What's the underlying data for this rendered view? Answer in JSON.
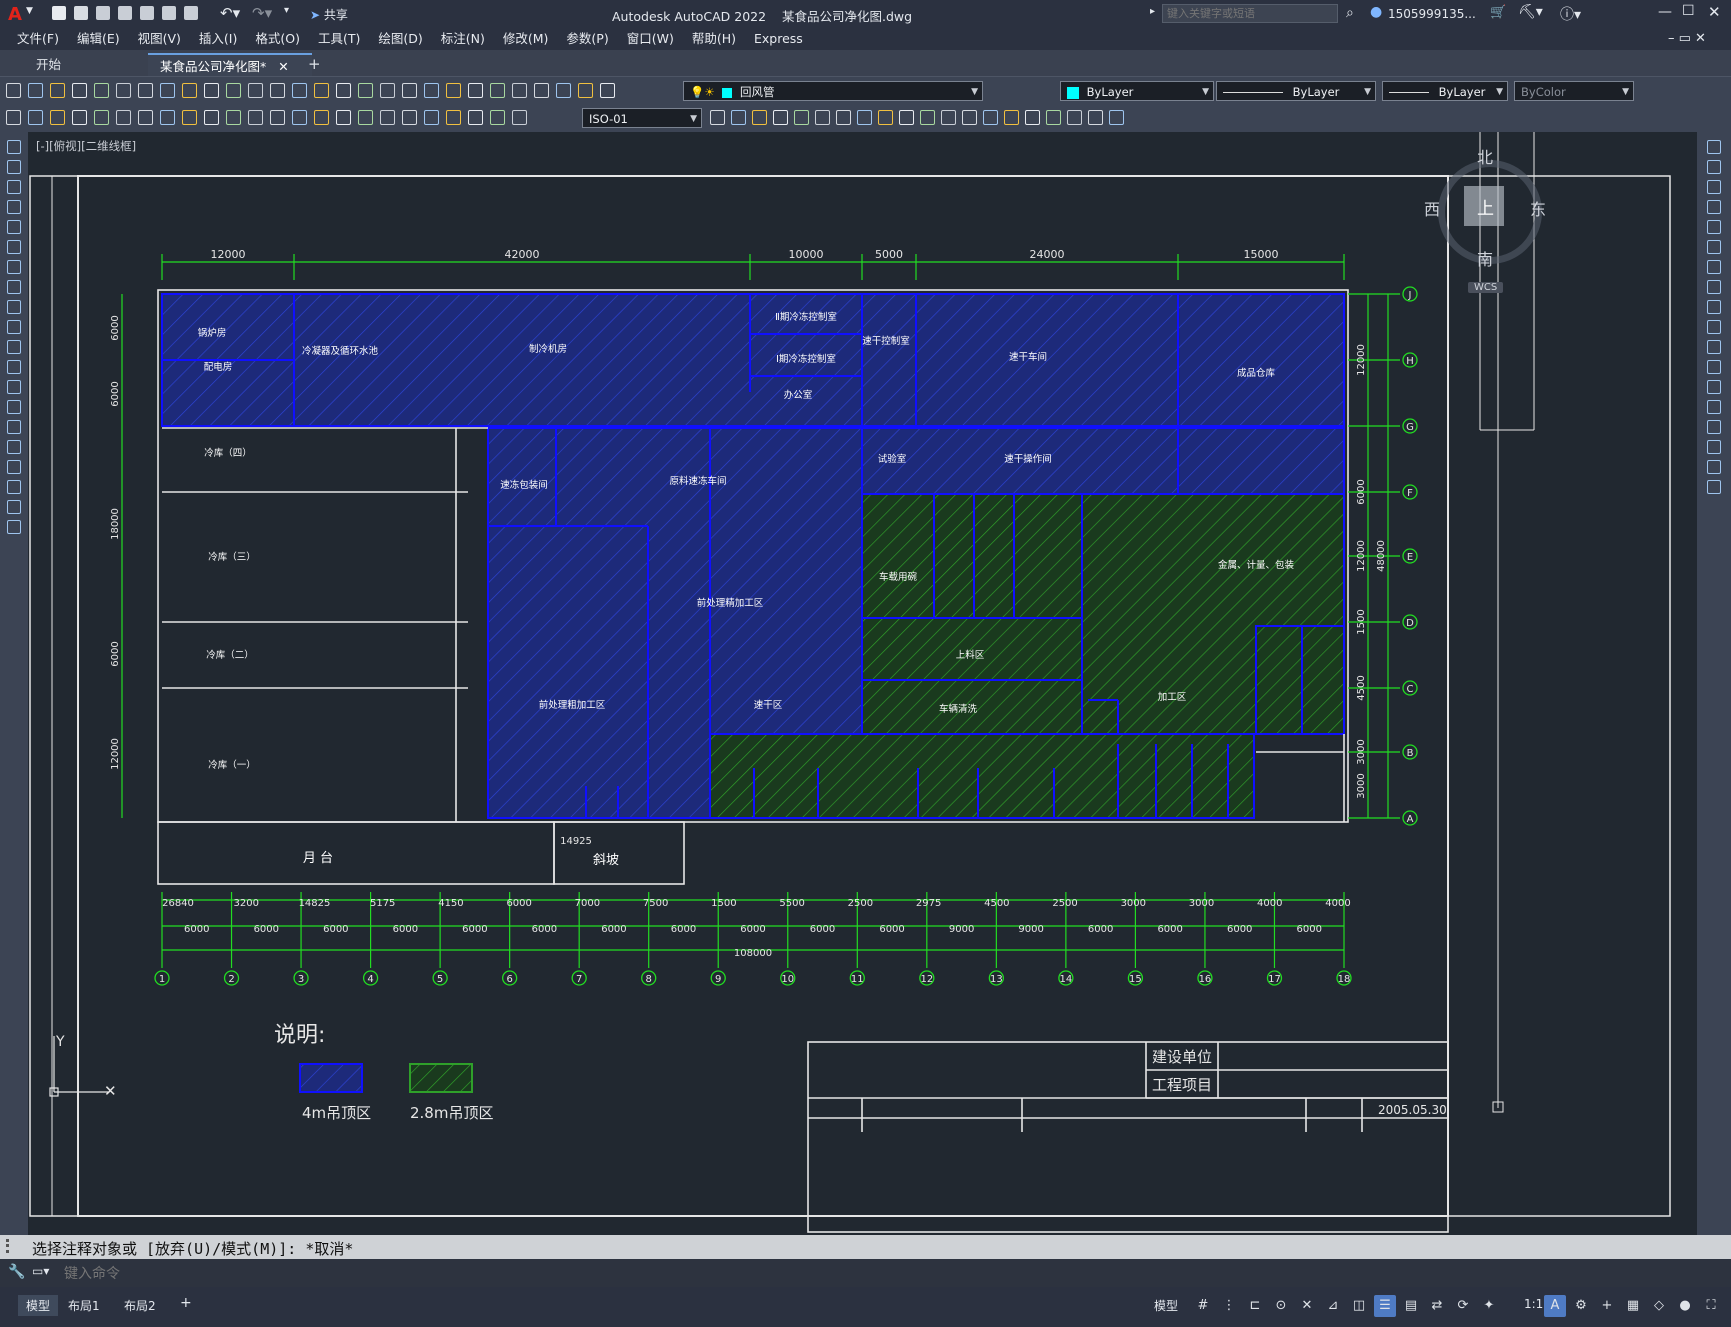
{
  "titlebar": {
    "app_title": "Autodesk AutoCAD 2022",
    "doc_title": "某食品公司净化图.dwg",
    "share_label": "共享",
    "search_placeholder": "键入关键字或短语",
    "user": "1505999135..."
  },
  "menu": [
    "文件(F)",
    "编辑(E)",
    "视图(V)",
    "插入(I)",
    "格式(O)",
    "工具(T)",
    "绘图(D)",
    "标注(N)",
    "修改(M)",
    "参数(P)",
    "窗口(W)",
    "帮助(H)",
    "Express"
  ],
  "tabs": [
    "开始",
    "某食品公司净化图*"
  ],
  "layer_value": "回风管",
  "color_value": "ByLayer",
  "linetype_value": "ByLayer",
  "lineweight_value": "ByLayer",
  "plotstyle_value": "ByColor",
  "dimstyle_value": "ISO-01",
  "viewport_label": "[-][俯视][二维线框]",
  "viewcube": {
    "north": "北",
    "south": "南",
    "east": "东",
    "west": "西",
    "top": "上",
    "wcs": "WCS"
  },
  "drawing": {
    "top_dims": [
      "12000",
      "42000",
      "10000",
      "5000",
      "24000",
      "15000"
    ],
    "right_axes": [
      "J",
      "H",
      "G",
      "F",
      "E",
      "D",
      "C",
      "B",
      "A"
    ],
    "right_dims": [
      "12000",
      "6000",
      "12000",
      "1500",
      "4500",
      "3000",
      "3000",
      "48000"
    ],
    "left_dims": [
      "6000",
      "6000",
      "18000",
      "6000",
      "12000"
    ],
    "bottom_dims_row1": [
      "26840",
      "3200",
      "14825",
      "5175",
      "4150",
      "6000",
      "7000",
      "7500",
      "1500",
      "5500",
      "2500",
      "2975",
      "4500",
      "2500",
      "3000",
      "3000",
      "4000",
      "4000"
    ],
    "bottom_dims_row2": [
      "6000",
      "6000",
      "6000",
      "6000",
      "6000",
      "6000",
      "6000",
      "6000",
      "6000",
      "6000",
      "6000",
      "9000",
      "9000",
      "6000",
      "6000",
      "6000",
      "6000",
      "6000"
    ],
    "total_dim": "108000",
    "bottom_axes": [
      "1",
      "2",
      "3",
      "4",
      "5",
      "6",
      "7",
      "8",
      "9",
      "10",
      "11",
      "12",
      "13",
      "14",
      "15",
      "16",
      "17",
      "18"
    ],
    "rooms": [
      "锅炉房",
      "配电房",
      "冷凝器及循环水池",
      "制冷机房",
      "Ⅱ期冷冻控制室",
      "Ⅰ期冷冻控制室",
      "办公室",
      "速干控制室",
      "速干车间",
      "成品仓库",
      "冷库（四）",
      "冷库（三）",
      "冷库（二）",
      "冷库（一）",
      "速冻包装间",
      "原料速冻车间",
      "前处理精加工区",
      "前处理粗加工区",
      "速干区",
      "试验室",
      "速干操作间",
      "车载用碗",
      "上料区",
      "车辆清洗",
      "加工区",
      "金属、计量、包装",
      "月 台",
      "斜坡"
    ],
    "small_dim": "14925",
    "legend_title": "说明:",
    "legend_blue": "4m吊顶区",
    "legend_green": "2.8m吊顶区",
    "titleblock": {
      "owner": "建设单位",
      "project": "工程项目",
      "date": "2005.05.30"
    }
  },
  "command": {
    "history": "选择注释对象或 [放弃(U)/模式(M)]: *取消*",
    "placeholder": "键入命令"
  },
  "layout_tabs": [
    "模型",
    "布局1",
    "布局2"
  ],
  "status": {
    "model": "模型",
    "scale": "1:1"
  },
  "colors": {
    "blue_hatch": "#1d2e9a",
    "green_hatch": "#1c6a18",
    "dim_green": "#22dd22",
    "wall_blue": "#1010ff",
    "white_line": "#e6e6e6"
  }
}
